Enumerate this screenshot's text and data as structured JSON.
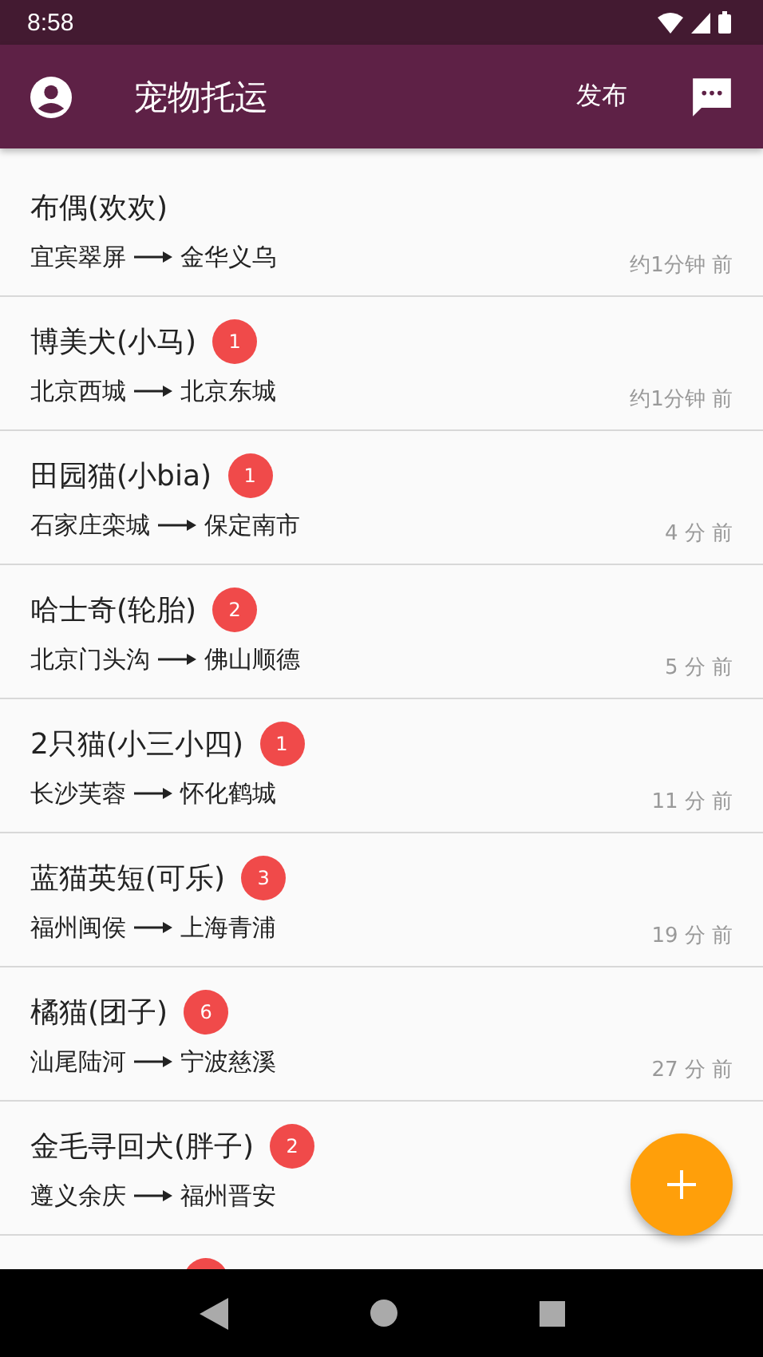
{
  "status_bar": {
    "time": "8:58"
  },
  "app_bar": {
    "title": "宠物托运",
    "action": "发布"
  },
  "items": [
    {
      "title": "布偶(欢欢)",
      "route_from": "宜宾翠屏",
      "route_to": "金华义乌",
      "time": "约1分钟 前"
    },
    {
      "title": "博美犬(小马)",
      "badge": "1",
      "route_from": "北京西城",
      "route_to": "北京东城",
      "time": "约1分钟 前"
    },
    {
      "title": "田园猫(小bia)",
      "badge": "1",
      "route_from": "石家庄栾城",
      "route_to": "保定南市",
      "time": "4 分 前"
    },
    {
      "title": "哈士奇(轮胎)",
      "badge": "2",
      "route_from": "北京门头沟",
      "route_to": "佛山顺德",
      "time": "5 分 前"
    },
    {
      "title": "2只猫(小三小四)",
      "badge": "1",
      "route_from": "长沙芙蓉",
      "route_to": "怀化鹤城",
      "time": "11 分 前"
    },
    {
      "title": "蓝猫英短(可乐)",
      "badge": "3",
      "route_from": "福州闽侯",
      "route_to": "上海青浦",
      "time": "19 分 前"
    },
    {
      "title": "橘猫(团子)",
      "badge": "6",
      "route_from": "汕尾陆河",
      "route_to": "宁波慈溪",
      "time": "27 分 前"
    },
    {
      "title": "金毛寻回犬(胖子)",
      "badge": "2",
      "route_from": "遵义余庆",
      "route_to": "福州晋安"
    },
    {
      "kind": "partial"
    }
  ]
}
